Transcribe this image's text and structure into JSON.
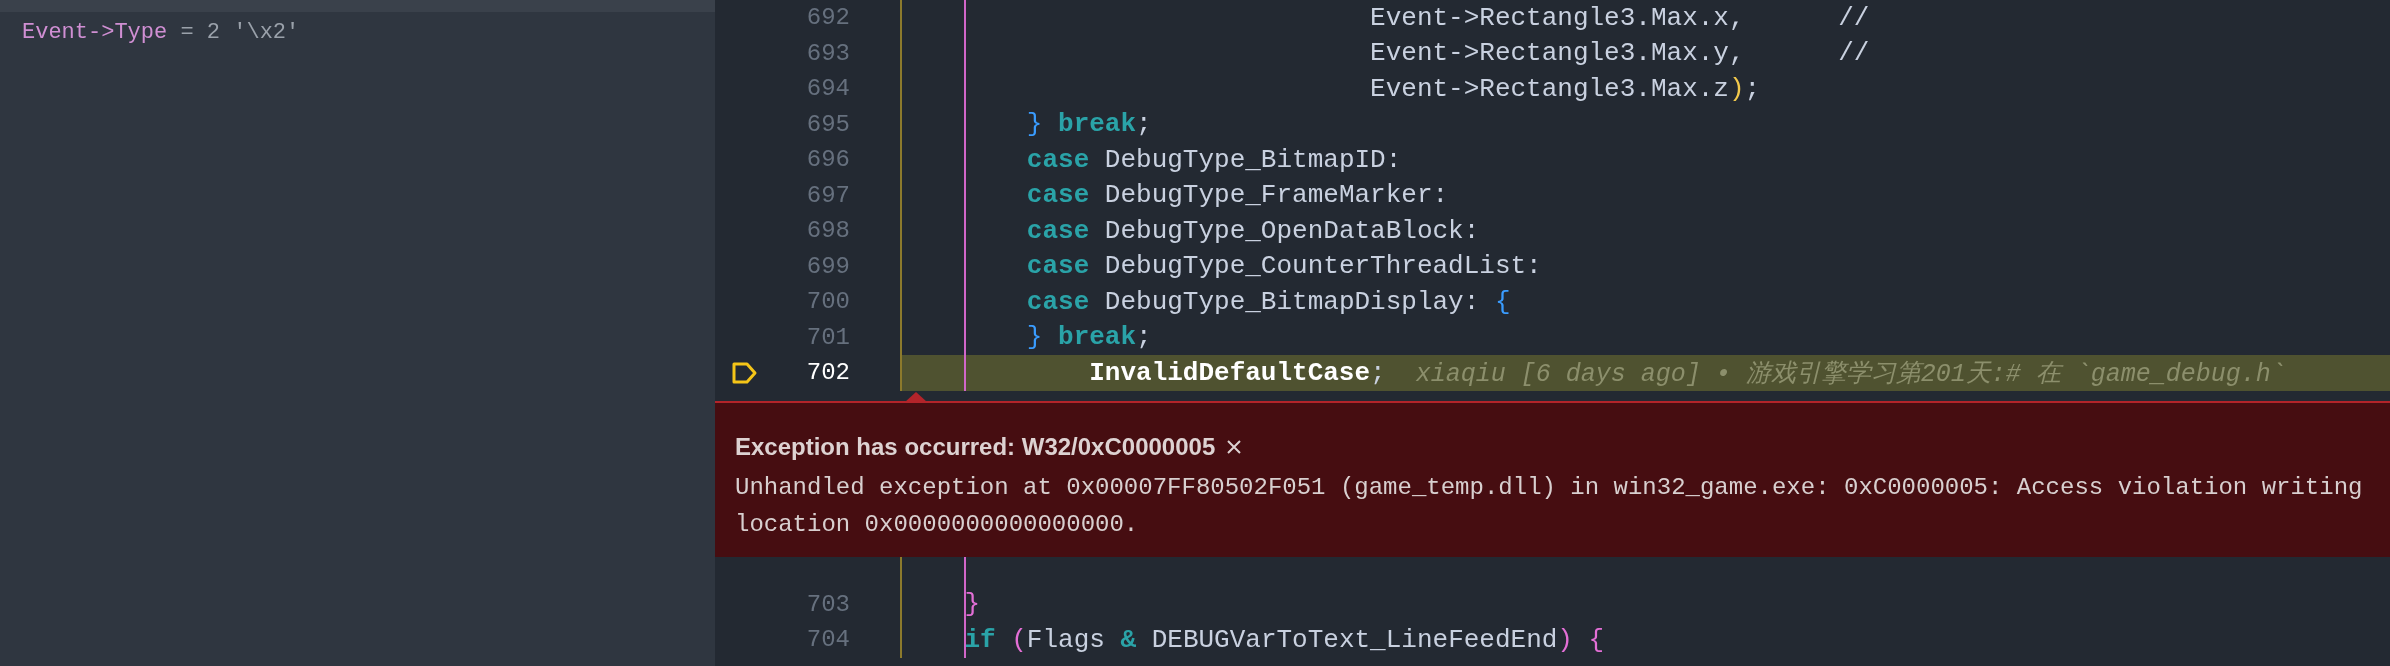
{
  "variables": [
    {
      "name": "Event->Type",
      "value": "= 2 '\\x2'"
    }
  ],
  "code_above": {
    "lines": [
      {
        "number": "692",
        "current": false,
        "tokens": [
          {
            "kind": "plain",
            "text": "                              Event->Rectangle3.Max.x,      "
          },
          {
            "kind": "comment",
            "text": "//"
          }
        ]
      },
      {
        "number": "693",
        "current": false,
        "tokens": [
          {
            "kind": "plain",
            "text": "                              Event->Rectangle3.Max.y,      "
          },
          {
            "kind": "comment",
            "text": "//"
          }
        ]
      },
      {
        "number": "694",
        "current": false,
        "tokens": [
          {
            "kind": "plain",
            "text": "                              Event->Rectangle3.Max.z"
          },
          {
            "kind": "paren",
            "text": ")"
          },
          {
            "kind": "plain",
            "text": ";"
          }
        ]
      },
      {
        "number": "695",
        "current": false,
        "tokens": [
          {
            "kind": "brace",
            "text": "        }"
          },
          {
            "kind": "keyword",
            "text": " break"
          },
          {
            "kind": "plain",
            "text": ";"
          }
        ]
      },
      {
        "number": "696",
        "current": false,
        "tokens": [
          {
            "kind": "keyword",
            "text": "        case"
          },
          {
            "kind": "plain",
            "text": " DebugType_BitmapID:"
          }
        ]
      },
      {
        "number": "697",
        "current": false,
        "tokens": [
          {
            "kind": "keyword",
            "text": "        case"
          },
          {
            "kind": "plain",
            "text": " DebugType_FrameMarker:"
          }
        ]
      },
      {
        "number": "698",
        "current": false,
        "tokens": [
          {
            "kind": "keyword",
            "text": "        case"
          },
          {
            "kind": "plain",
            "text": " DebugType_OpenDataBlock:"
          }
        ]
      },
      {
        "number": "699",
        "current": false,
        "tokens": [
          {
            "kind": "keyword",
            "text": "        case"
          },
          {
            "kind": "plain",
            "text": " DebugType_CounterThreadList:"
          }
        ]
      },
      {
        "number": "700",
        "current": false,
        "tokens": [
          {
            "kind": "keyword",
            "text": "        case"
          },
          {
            "kind": "plain",
            "text": " DebugType_BitmapDisplay: "
          },
          {
            "kind": "brace",
            "text": "{"
          }
        ]
      },
      {
        "number": "701",
        "current": false,
        "tokens": [
          {
            "kind": "brace",
            "text": "        }"
          },
          {
            "kind": "keyword",
            "text": " break"
          },
          {
            "kind": "plain",
            "text": ";"
          }
        ]
      },
      {
        "number": "702",
        "current": true,
        "blame": "xiaqiu [6 days ago] • 游戏引擎学习第201天:# 在 `game_debug.h`",
        "tokens": [
          {
            "kind": "strong",
            "text": "            InvalidDefaultCase"
          },
          {
            "kind": "plain",
            "text": ";"
          }
        ]
      }
    ]
  },
  "exception": {
    "title": "Exception has occurred: W32/0xC0000005",
    "message": "Unhandled exception at 0x00007FF80502F051 (game_temp.dll) in win32_game.exe: 0xC0000005: Access violation writing location 0x0000000000000000."
  },
  "code_below": {
    "lines": [
      {
        "number": "703",
        "current": false,
        "tokens": [
          {
            "kind": "pink",
            "text": "    }"
          }
        ]
      },
      {
        "number": "704",
        "current": false,
        "tokens": [
          {
            "kind": "keyword",
            "text": "    if"
          },
          {
            "kind": "pink",
            "text": " ("
          },
          {
            "kind": "plain",
            "text": "Flags "
          },
          {
            "kind": "operator",
            "text": "&"
          },
          {
            "kind": "plain",
            "text": " DEBUGVarToText_LineFeedEnd"
          },
          {
            "kind": "pink",
            "text": ") {"
          }
        ]
      }
    ]
  }
}
